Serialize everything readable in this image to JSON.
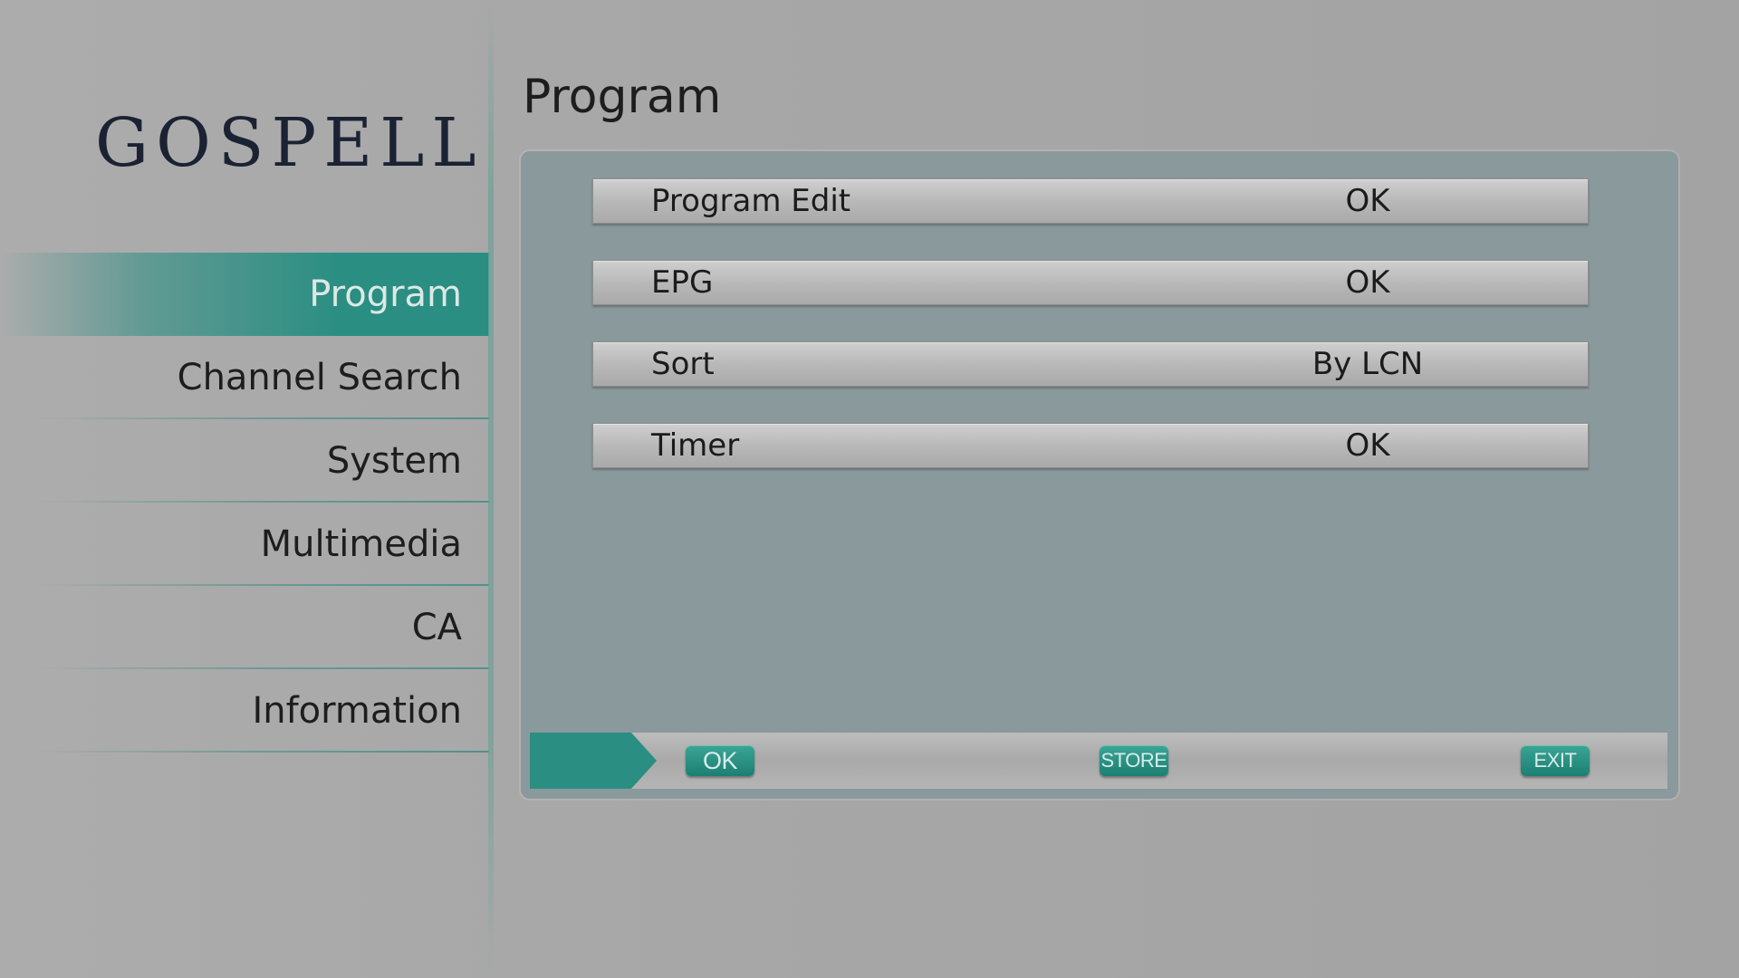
{
  "brand": {
    "logo_text": "GOSPELL"
  },
  "sidebar": {
    "items": [
      {
        "label": "Program",
        "active": true
      },
      {
        "label": "Channel Search",
        "active": false
      },
      {
        "label": "System",
        "active": false
      },
      {
        "label": "Multimedia",
        "active": false
      },
      {
        "label": "CA",
        "active": false
      },
      {
        "label": "Information",
        "active": false
      }
    ]
  },
  "main": {
    "title": "Program",
    "menu": [
      {
        "label": "Program Edit",
        "value": "OK"
      },
      {
        "label": "EPG",
        "value": "OK"
      },
      {
        "label": "Sort",
        "value": "By LCN"
      },
      {
        "label": "Timer",
        "value": "OK"
      }
    ]
  },
  "footer": {
    "ok_label": "OK",
    "store_label": "STORE",
    "exit_label": "EXIT"
  },
  "colors": {
    "accent": "#2a8e82",
    "panel": "#8a999b",
    "background": "#a9a9a9"
  }
}
